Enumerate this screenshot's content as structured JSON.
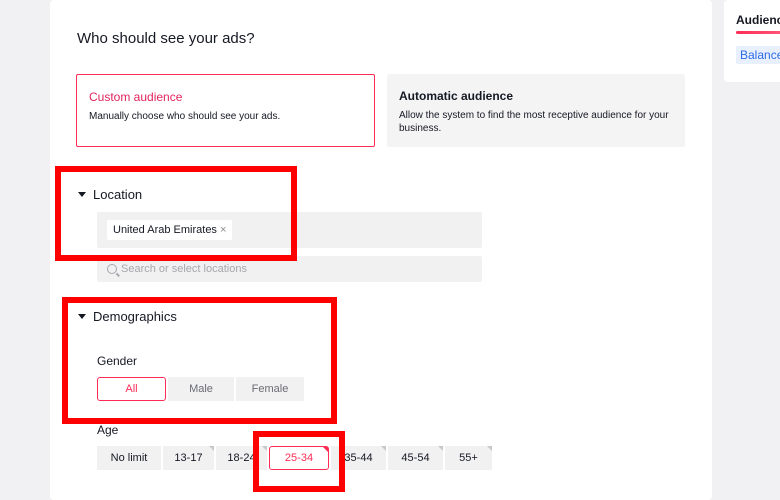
{
  "page": {
    "title": "Who should see your ads?"
  },
  "side_panel": {
    "title": "Audience",
    "badge": "Balance"
  },
  "audience_options": [
    {
      "title": "Custom audience",
      "description": "Manually choose who should see your ads.",
      "selected": true
    },
    {
      "title": "Automatic audience",
      "description": "Allow the system to find the most receptive audience for your business.",
      "selected": false
    }
  ],
  "location": {
    "heading": "Location",
    "tags": [
      {
        "label": "United Arab Emirates",
        "remove": "×"
      }
    ],
    "search_placeholder": "Search or select locations"
  },
  "demographics": {
    "heading": "Demographics",
    "gender": {
      "label": "Gender",
      "options": [
        "All",
        "Male",
        "Female"
      ],
      "selected": "All"
    },
    "age": {
      "label": "Age",
      "options": [
        "No limit",
        "13-17",
        "18-24",
        "25-34",
        "35-44",
        "45-54",
        "55+"
      ],
      "selected": "25-34"
    }
  },
  "colors": {
    "accent": "#fe2c55",
    "highlight": "#ff0000"
  }
}
